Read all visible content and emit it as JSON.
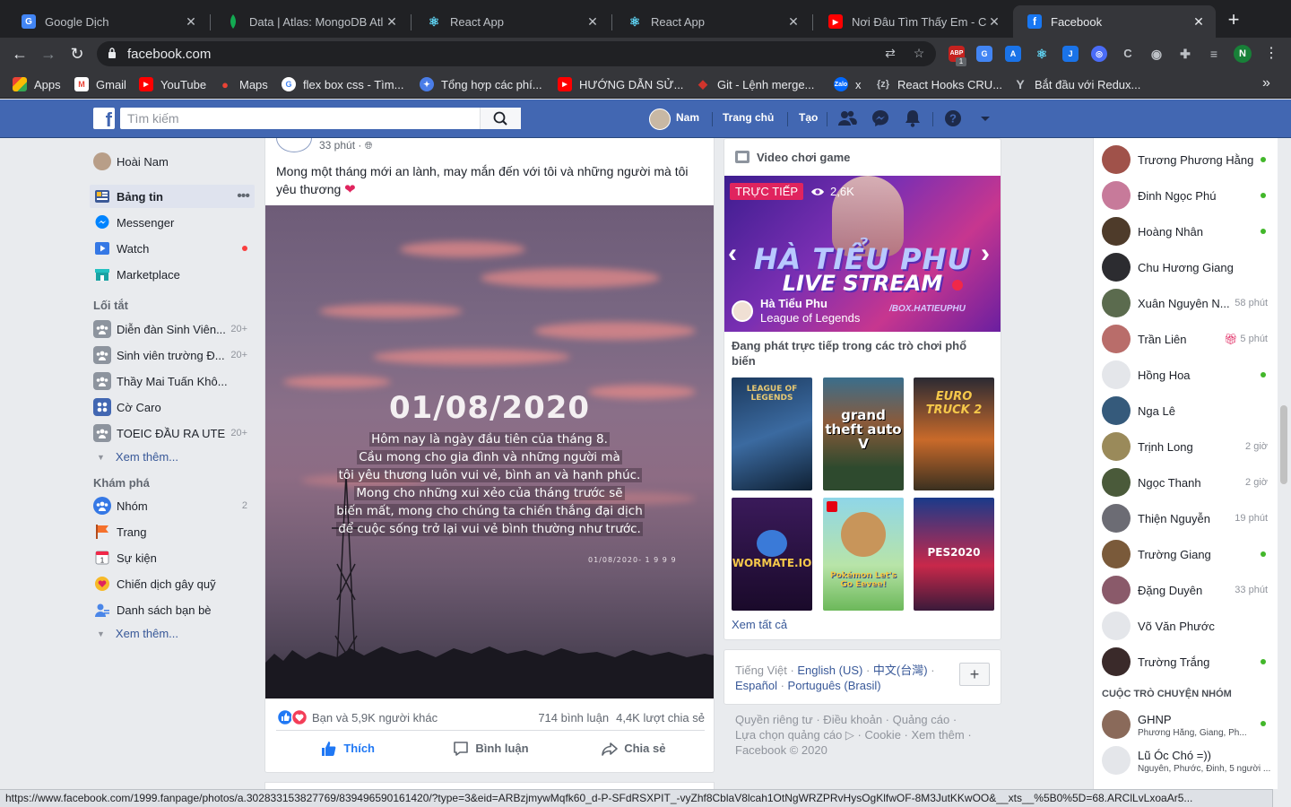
{
  "browser": {
    "tabs": [
      {
        "title": "Google Dịch",
        "favicon": "google-translate-icon"
      },
      {
        "title": "Data | Atlas: MongoDB Atlas",
        "favicon": "mongodb-leaf-icon"
      },
      {
        "title": "React App",
        "favicon": "react-icon"
      },
      {
        "title": "React App",
        "favicon": "react-icon"
      },
      {
        "title": "Nơi Đâu Tìm Thấy Em - Chu",
        "favicon": "youtube-icon"
      },
      {
        "title": "Facebook",
        "favicon": "facebook-icon",
        "active": true
      }
    ],
    "url": "facebook.com",
    "profile_initial": "N",
    "ext_badge": "1",
    "bookmarks": [
      {
        "label": "Apps"
      },
      {
        "label": "Gmail"
      },
      {
        "label": "YouTube"
      },
      {
        "label": "Maps"
      },
      {
        "label": "flex box css - Tìm..."
      },
      {
        "label": "Tổng hợp các phí..."
      },
      {
        "label": "HƯỚNG DẪN SỬ..."
      },
      {
        "label": "Git - Lệnh merge..."
      },
      {
        "label": "x"
      },
      {
        "label": "React Hooks CRU..."
      },
      {
        "label": "Bắt đầu với Redux..."
      }
    ],
    "status_url": "https://www.facebook.com/1999.fanpage/photos/a.302833153827769/839496590161420/?type=3&eid=ARBzjmywMqfk60_d-P-SFdRSXPIT_-vyZhf8CblaV8lcah1OtNgWRZPRvHysOgKlfwOF-8M3JutKKwOO&__xts__%5B0%5D=68.ARClLvLxoaAr5..."
  },
  "fb_header": {
    "search_placeholder": "Tìm kiếm",
    "user_name": "Nam",
    "home": "Trang chủ",
    "create": "Tạo"
  },
  "left_nav": {
    "profile_name": "Hoài Nam",
    "main": [
      {
        "label": "Bảng tin",
        "active": true
      },
      {
        "label": "Messenger"
      },
      {
        "label": "Watch",
        "badge_dot": true
      },
      {
        "label": "Marketplace"
      }
    ],
    "shortcuts_title": "Lối tắt",
    "shortcuts": [
      {
        "label": "Diễn đàn Sinh Viên...",
        "count": "20+"
      },
      {
        "label": "Sinh viên trường Đ...",
        "count": "20+"
      },
      {
        "label": "Thầy Mai Tuấn Khô...",
        "count": ""
      },
      {
        "label": "Cờ Caro",
        "count": ""
      },
      {
        "label": "TOEIC ĐẦU RA UTE",
        "count": "20+"
      }
    ],
    "see_more_1": "Xem thêm...",
    "explore_title": "Khám phá",
    "explore": [
      {
        "label": "Nhóm",
        "count": "2"
      },
      {
        "label": "Trang",
        "count": ""
      },
      {
        "label": "Sự kiện",
        "count": ""
      },
      {
        "label": "Chiến dịch gây quỹ",
        "count": ""
      },
      {
        "label": "Danh sách bạn bè",
        "count": ""
      }
    ],
    "see_more_2": "Xem thêm...",
    "event_icon_day": "1"
  },
  "post": {
    "time": "33 phút ·",
    "text": "Mong một tháng mới an lành, may mắn đến với tôi và những người mà tôi yêu thương",
    "image_date": "01/08/2020",
    "image_lines": [
      "Hôm nay là ngày đầu tiên của tháng 8.",
      "Cầu mong cho gia đình và những người mà",
      "tôi yêu thương luôn vui vẻ, bình an và hạnh phúc.",
      "Mong cho những xui xẻo của tháng trước sẽ",
      "biến mất, mong cho chúng ta chiến thắng đại dịch",
      "để cuộc sống trở lại vui vẻ bình thường như trước."
    ],
    "image_signature": "01/08/2020- 1 9 9 9",
    "reactions_text": "Bạn và 5,9K người khác",
    "comments": "714 bình luận",
    "shares": "4,4K lượt chia sẻ",
    "like": "Thích",
    "comment": "Bình luận",
    "share": "Chia sẻ"
  },
  "game_card": {
    "title": "Video chơi game",
    "live": "TRỰC TIẾP",
    "viewers": "2,6K",
    "video_title_1": "HÀ TIỂU PHU",
    "video_title_2": "LIVE STREAM",
    "streamer": "Hà Tiểu Phu",
    "game": "League of Legends",
    "channel": "/BOX.HATIEUPHU",
    "description": "Đang phát trực tiếp trong các trò chơi phổ biến",
    "thumbs": [
      {
        "label": "LEAGUE OF LEGENDS"
      },
      {
        "label": "grand theft auto V"
      },
      {
        "label": "EURO TRUCK 2"
      },
      {
        "label": "WORMATE.IO"
      },
      {
        "label": "Pokémon Let's Go Eevee!"
      },
      {
        "label": "PES2020"
      }
    ],
    "see_all": "Xem tất cả"
  },
  "languages": {
    "current": "Tiếng Việt",
    "options": [
      "English (US)",
      "中文(台灣)",
      "Español",
      "Português (Brasil)"
    ],
    "add": "+"
  },
  "footer": {
    "line1": "Quyền riêng tư · Điều khoản · Quảng cáo ·",
    "line2": "Lựa chọn quảng cáo ▷ · Cookie · Xem thêm ·",
    "line3": "Facebook © 2020"
  },
  "chat": {
    "contacts": [
      {
        "name": "Trương Phương Hằng",
        "status": "",
        "online": true,
        "color": "#a0524a"
      },
      {
        "name": "Đinh Ngọc Phú",
        "status": "",
        "online": true,
        "color": "#c77a9a"
      },
      {
        "name": "Hoàng Nhân",
        "status": "",
        "online": true,
        "color": "#4e3b2a"
      },
      {
        "name": "Chu Hương Giang",
        "status": "",
        "online": false,
        "color": "#2c2c30"
      },
      {
        "name": "Xuân Nguyên N...",
        "status": "58 phút",
        "online": false,
        "color": "#5b6b4e"
      },
      {
        "name": "Trần Liên",
        "status": "5 phút",
        "online": false,
        "color": "#b96d6a",
        "gift": true
      },
      {
        "name": "Hồng Hoa",
        "status": "",
        "online": true,
        "color": "#e4e6ea"
      },
      {
        "name": "Nga Lê",
        "status": "",
        "online": false,
        "color": "#355a7b"
      },
      {
        "name": "Trịnh Long",
        "status": "2 giờ",
        "online": false,
        "color": "#9a8a5a"
      },
      {
        "name": "Ngọc Thanh",
        "status": "2 giờ",
        "online": false,
        "color": "#4a5a3a"
      },
      {
        "name": "Thiện Nguyễn",
        "status": "19 phút",
        "online": false,
        "color": "#6c6c74"
      },
      {
        "name": "Trường Giang",
        "status": "",
        "online": true,
        "color": "#7a5a3a"
      },
      {
        "name": "Đặng Duyên",
        "status": "33 phút",
        "online": false,
        "color": "#8a5a6a"
      },
      {
        "name": "Võ Văn Phước",
        "status": "",
        "online": false,
        "color": "#e4e6ea"
      },
      {
        "name": "Trường Trắng",
        "status": "",
        "online": true,
        "color": "#3a2a2a"
      }
    ],
    "groups_title": "CUỘC TRÒ CHUYỆN NHÓM",
    "groups": [
      {
        "name": "GHNP",
        "members": "Phương Hằng, Giang, Ph...",
        "online": true
      },
      {
        "name": "Lũ Óc Chó =))",
        "members": "Nguyên, Phước, Đinh, 5 người ...",
        "online": false
      }
    ]
  }
}
